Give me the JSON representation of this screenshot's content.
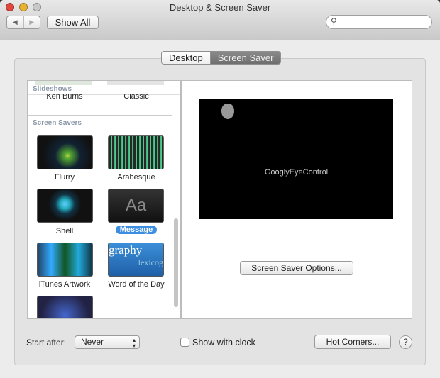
{
  "window": {
    "title": "Desktop & Screen Saver"
  },
  "toolbar": {
    "show_all": "Show All",
    "back": "◀",
    "forward": "▶",
    "search_placeholder": ""
  },
  "tabs": [
    {
      "label": "Desktop",
      "selected": false
    },
    {
      "label": "Screen Saver",
      "selected": true
    }
  ],
  "list": {
    "slideshows_header": "Slideshows",
    "slideshows": [
      "Ken Burns",
      "Classic"
    ],
    "screensavers_header": "Screen Savers",
    "screensavers": [
      "Flurry",
      "Arabesque",
      "Shell",
      "Message",
      "iTunes Artwork",
      "Word of the Day"
    ],
    "selected": "Message",
    "message_thumb_text": "Aa",
    "word_thumb_text": "graphy",
    "word_thumb_text2": "lexicog"
  },
  "preview": {
    "text": "GooglyEyeControl",
    "options_button": "Screen Saver Options..."
  },
  "bottom": {
    "start_after_label": "Start after:",
    "start_after_value": "Never",
    "show_clock_label": "Show with clock",
    "show_clock_checked": false,
    "hot_corners": "Hot Corners...",
    "help": "?"
  }
}
